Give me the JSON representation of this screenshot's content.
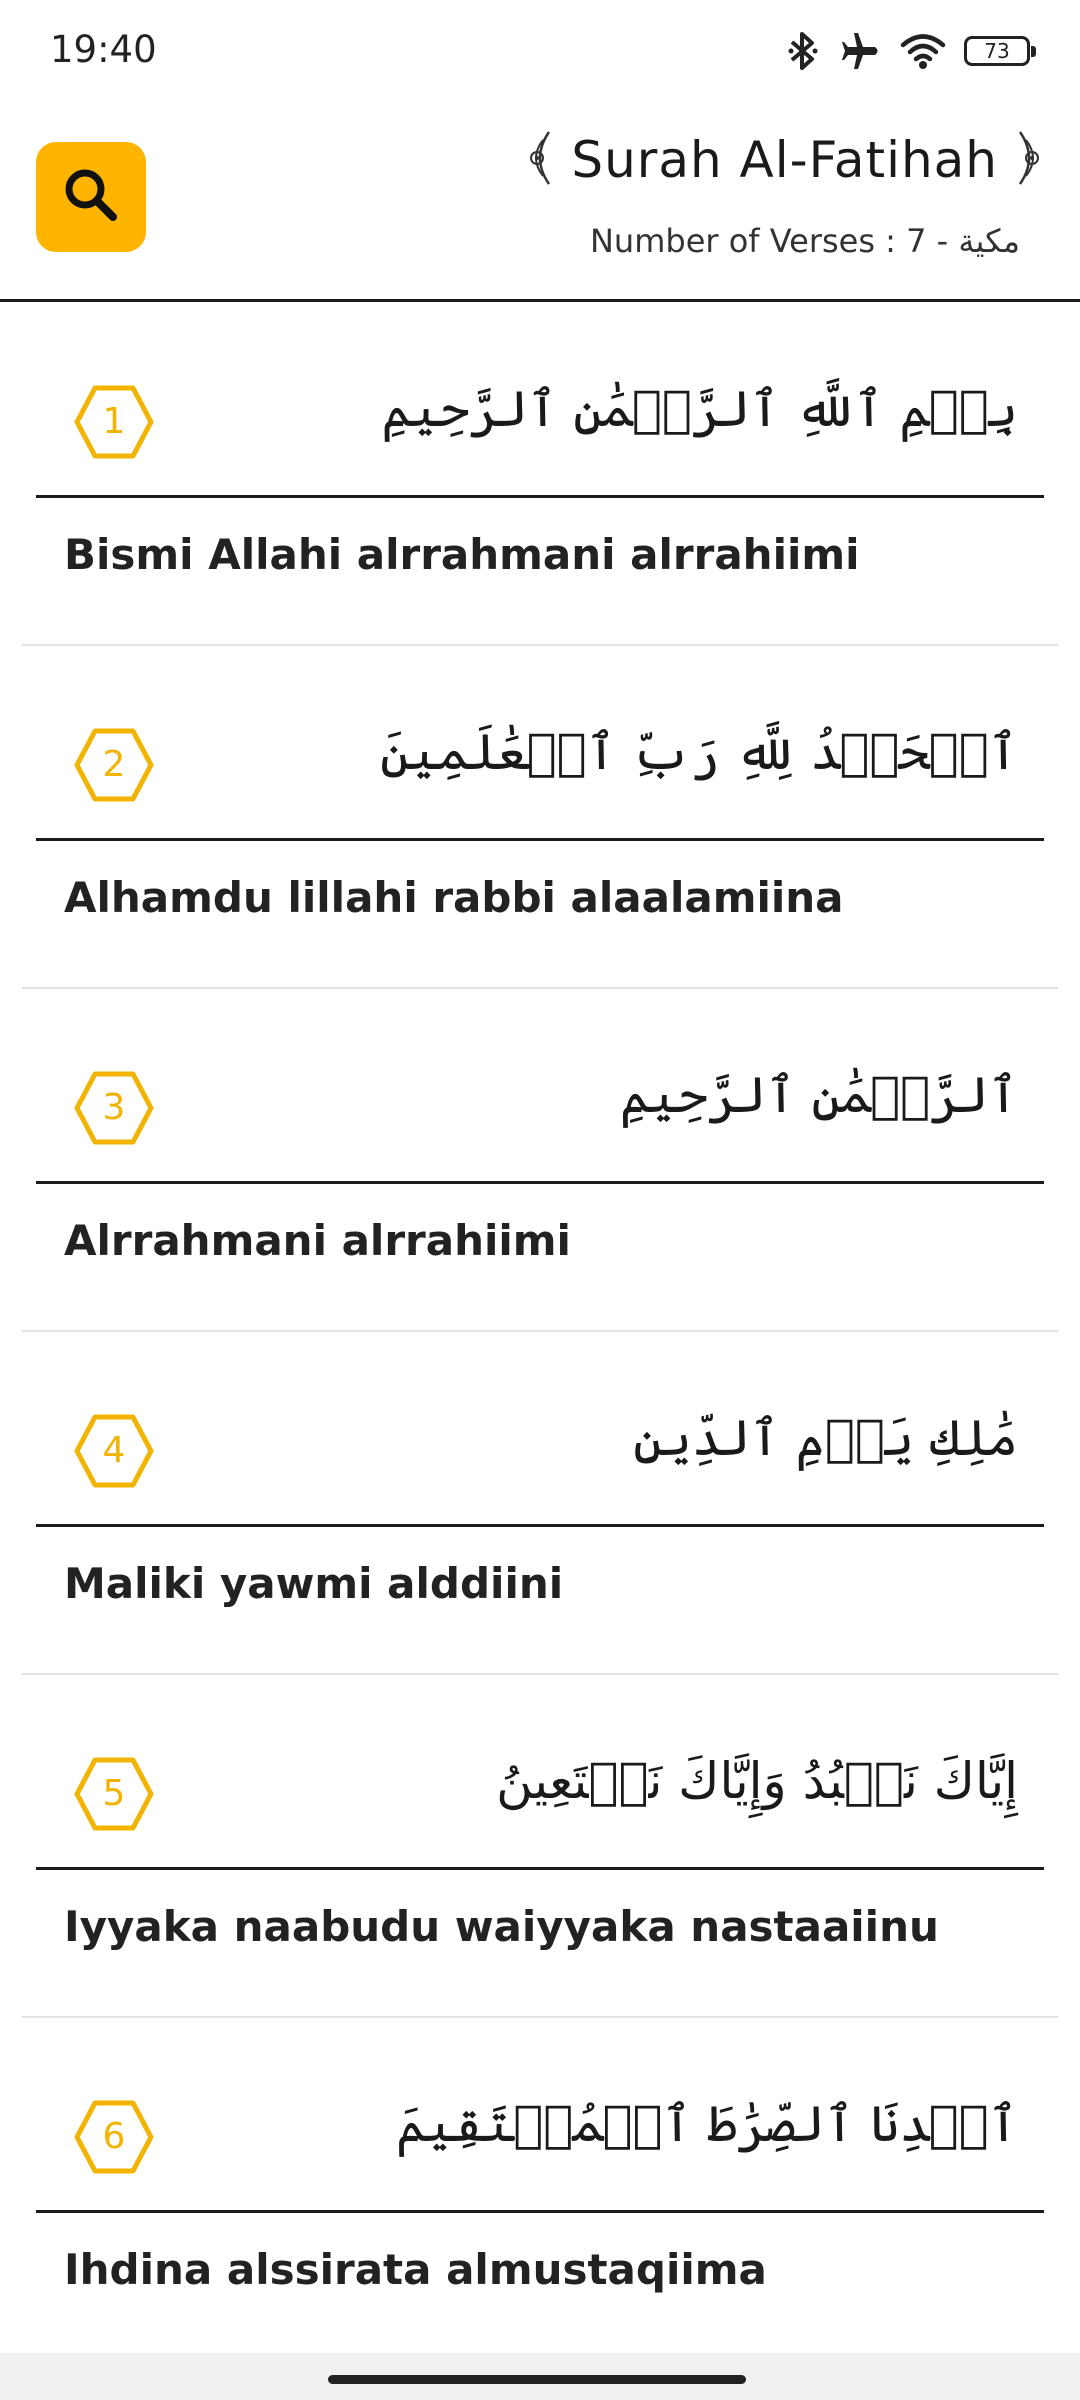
{
  "status_bar": {
    "time": "19:40",
    "battery": "73",
    "icons": [
      "bluetooth-icon",
      "airplane-icon",
      "wifi-icon",
      "battery-icon"
    ]
  },
  "header": {
    "title": "Surah Al-Fatihah",
    "subtitle": "Number of Verses : 7 - مكية",
    "search_icon": "search-icon",
    "accent_color": "#ffb400"
  },
  "verses": [
    {
      "number": "1",
      "arabic": "بِسۡمِ ٱللَّهِ ٱلرَّحۡمَٰنِ ٱلرَّحِيمِ",
      "transliteration": "Bismi Allahi alrrahmani alrrahiimi"
    },
    {
      "number": "2",
      "arabic": "ٱلۡحَمۡدُ لِلَّهِ رَبِّ ٱلۡعَٰلَمِينَ",
      "transliteration": "Alhamdu lillahi rabbi alaalamiina"
    },
    {
      "number": "3",
      "arabic": "ٱلرَّحۡمَٰنِ ٱلرَّحِيمِ",
      "transliteration": "Alrrahmani alrrahiimi"
    },
    {
      "number": "4",
      "arabic": "مَٰلِكِ يَوۡمِ ٱلدِّينِ",
      "transliteration": "Maliki yawmi alddiini"
    },
    {
      "number": "5",
      "arabic": "إِيَّاكَ نَعۡبُدُ وَإِيَّاكَ نَسۡتَعِينُ",
      "transliteration": "Iyyaka naabudu waiyyaka nastaaiinu"
    },
    {
      "number": "6",
      "arabic": "ٱهۡدِنَا ٱلصِّرَٰطَ ٱلۡمُسۡتَقِيمَ",
      "transliteration": "Ihdina alssirata almustaqiima"
    }
  ]
}
